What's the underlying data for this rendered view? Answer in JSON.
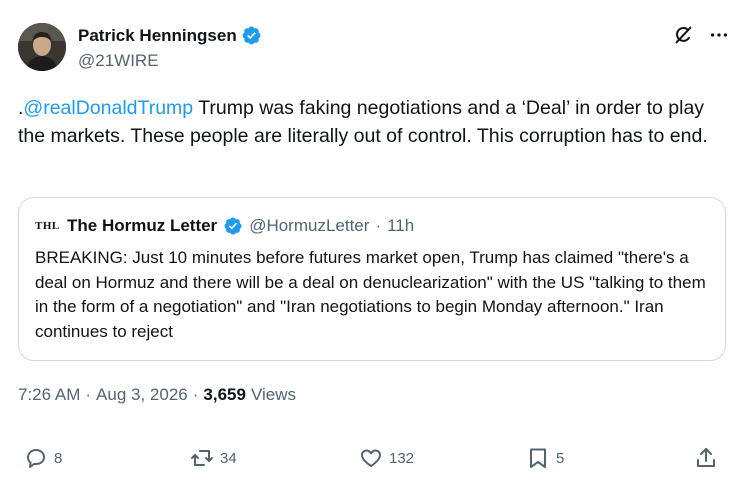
{
  "author": {
    "display_name": "Patrick Henningsen",
    "handle": "@21WIRE",
    "verified": true
  },
  "tweet": {
    "prefix": ".",
    "mention": "@realDonaldTrump",
    "text": " Trump was faking negotiations and a ‘Deal’ in order to play the markets. These people are literally out of control. This corruption has to end."
  },
  "quote": {
    "logo_text": "THL",
    "name": "The Hormuz Letter",
    "handle": "@HormuzLetter",
    "separator": "·",
    "time": "11h",
    "body": "BREAKING: Just 10 minutes before futures market open, Trump has claimed \"there's a deal on Hormuz and there will be a deal on denuclearization\" with the US \"talking to them in the form of a negotiation\" and \"Iran negotiations to begin Monday afternoon.\" Iran continues to reject"
  },
  "meta": {
    "time": "7:26 AM",
    "sep1": "·",
    "date": "Aug 3, 2026",
    "sep2": "·",
    "views_count": "3,659",
    "views_label": "Views"
  },
  "actions": {
    "replies": "8",
    "reposts": "34",
    "likes": "132",
    "bookmarks": "5"
  },
  "colors": {
    "accent": "#1d9bf0",
    "text": "#0f1419",
    "secondary": "#536471",
    "border": "#cfd9de"
  },
  "icons": [
    "verified-badge-icon",
    "grok-icon",
    "more-icon",
    "reply-icon",
    "repost-icon",
    "like-icon",
    "bookmark-icon",
    "share-icon"
  ]
}
